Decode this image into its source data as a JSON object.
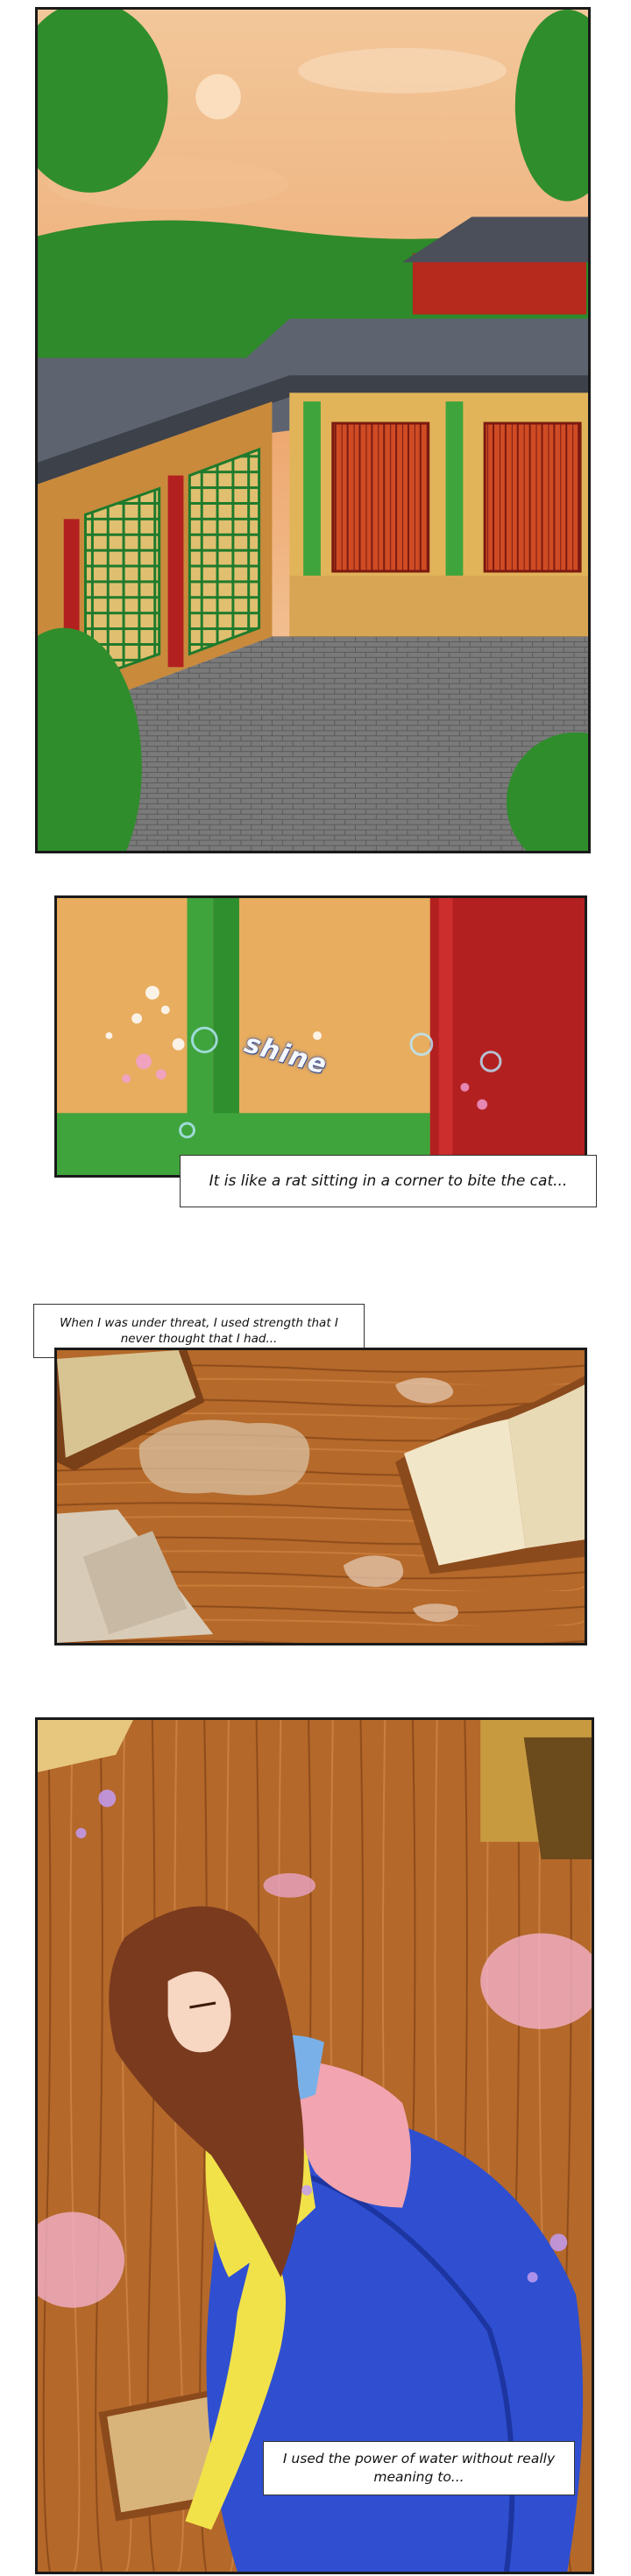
{
  "panels": [
    {
      "scene": "palace-courtyard-sunset"
    },
    {
      "scene": "sparkling-wall-corner"
    },
    {
      "scene": "floor-with-books-and-puddles"
    },
    {
      "scene": "girl-kneeling-on-floor"
    }
  ],
  "captions": {
    "caption_1": "It is like a rat sitting in a corner to bite the cat...",
    "caption_2": "When I was under threat, I used strength that I never thought that I had...",
    "caption_3": "I used the power of water without really meaning to..."
  },
  "sfx": {
    "shine": "shine"
  },
  "colors": {
    "sky": "#f0b88a",
    "roof": "#5d6470",
    "wall_gold": "#e2b45a",
    "pillar_red": "#b32020",
    "trim_green": "#3fa43c",
    "floor_wood": "#b5692a",
    "hanbok_blue": "#2f4fd0",
    "hanbok_yellow": "#f2e24a",
    "jacket_pink": "#f2a4b0"
  }
}
